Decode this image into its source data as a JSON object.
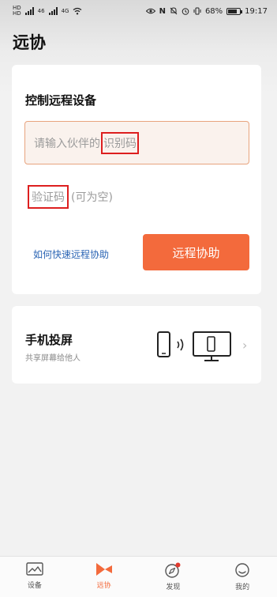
{
  "status_bar": {
    "carrier_labels": [
      "HD",
      "HD"
    ],
    "network_labels": [
      "46",
      "4G"
    ],
    "battery_percent": "68%",
    "battery_level": 0.68,
    "time": "19:17"
  },
  "page": {
    "title": "远协"
  },
  "remote_card": {
    "heading": "控制远程设备",
    "id_field": {
      "placeholder_prefix": "请输入伙伴的",
      "placeholder_highlight": "识别码"
    },
    "code_field": {
      "placeholder_highlight": "验证码",
      "placeholder_suffix": "(可为空)"
    },
    "help_link": "如何快速远程协助",
    "action_button": "远程协助"
  },
  "cast_card": {
    "title": "手机投屏",
    "subtitle": "共享屏幕给他人"
  },
  "tabbar": {
    "active_index": 1,
    "items": [
      {
        "label": "设备",
        "icon": "device-icon"
      },
      {
        "label": "远协",
        "icon": "remote-assist-icon"
      },
      {
        "label": "发现",
        "icon": "compass-icon"
      },
      {
        "label": "我的",
        "icon": "profile-icon"
      }
    ]
  },
  "colors": {
    "accent": "#f36a3c",
    "link": "#2a64b4",
    "annotation": "#dd1f1f",
    "notification_dot": "#e23a2e"
  }
}
